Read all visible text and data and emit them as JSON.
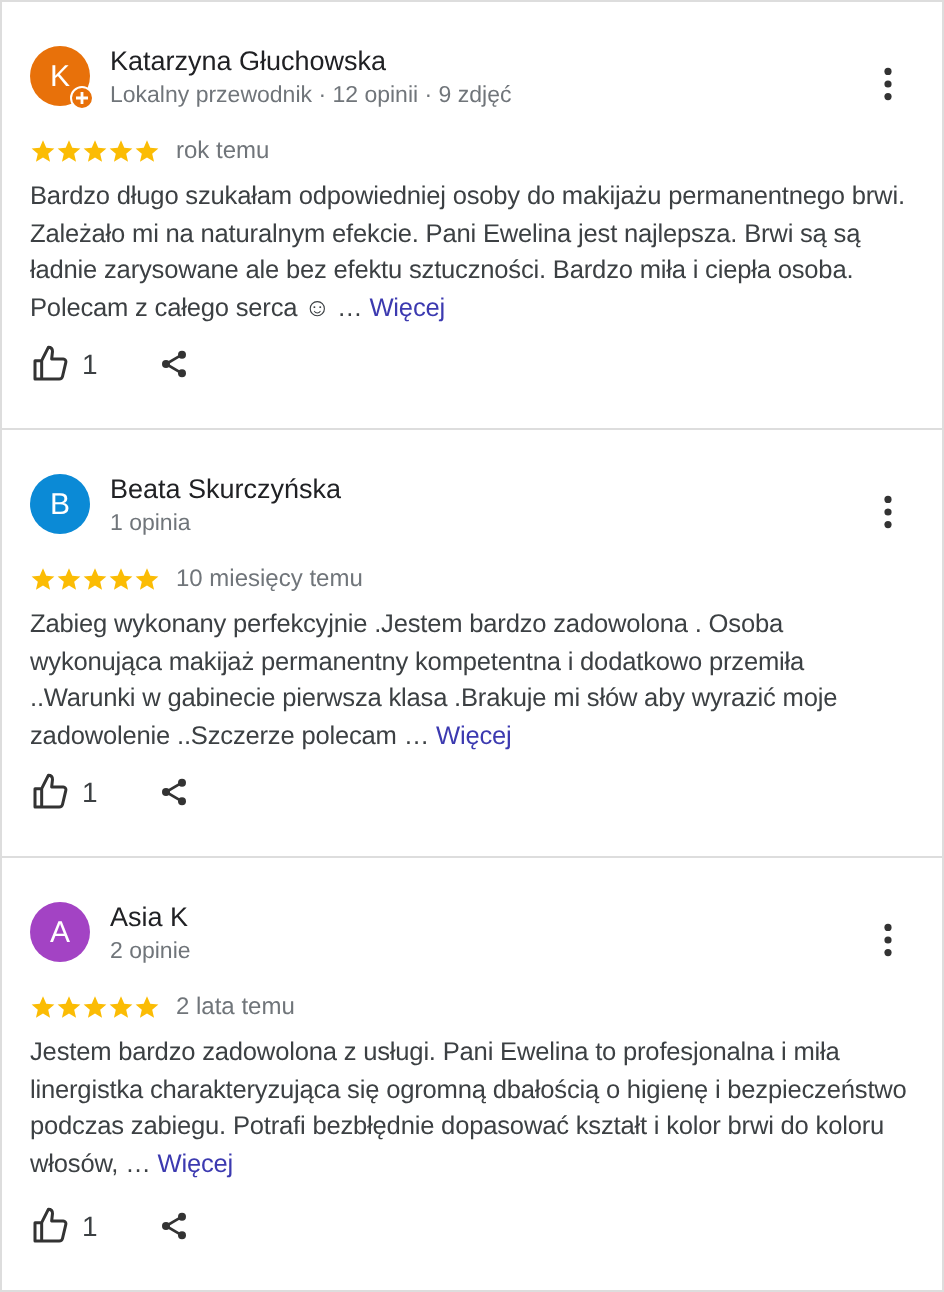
{
  "reviews": [
    {
      "initial": "K",
      "color": "#e8710a",
      "local_guide": true,
      "name": "Katarzyna Głuchowska",
      "meta": "Lokalny przewodnik · 12 opinii · 9 zdjęć",
      "stars": 5,
      "time": "rok temu",
      "text": "Bardzo długo szukałam odpowiedniej osoby do makijażu permanentnego brwi. Zależało mi na naturalnym efekcie. Pani Ewelina jest najlepsza. Brwi są są ładnie zarysowane ale bez efektu sztuczności. Bardzo miła i ciepła osoba. Polecam z całego serca ☺ …",
      "more": "Więcej",
      "likes": "1"
    },
    {
      "initial": "B",
      "color": "#0b8ad6",
      "local_guide": false,
      "name": "Beata Skurczyńska",
      "meta": "1 opinia",
      "stars": 5,
      "time": "10 miesięcy temu",
      "text": "Zabieg wykonany perfekcyjnie .Jestem bardzo zadowolona . Osoba wykonująca makijaż permanentny kompetentna i dodatkowo przemiła ..Warunki w gabinecie pierwsza klasa .Brakuje mi słów aby wyrazić moje zadowolenie ..Szczerze polecam …",
      "more": "Więcej",
      "likes": "1"
    },
    {
      "initial": "A",
      "color": "#a343c4",
      "local_guide": false,
      "name": "Asia K",
      "meta": "2 opinie",
      "stars": 5,
      "time": "2 lata temu",
      "text": "Jestem bardzo zadowolona z usługi. Pani Ewelina to profesjonalna i miła linergistka charakteryzująca się ogromną dbałością o higienę i bezpieczeństwo podczas zabiegu. Potrafi bezbłędnie dopasować kształt i kolor brwi do koloru włosów, …",
      "more": "Więcej",
      "likes": "1"
    }
  ]
}
